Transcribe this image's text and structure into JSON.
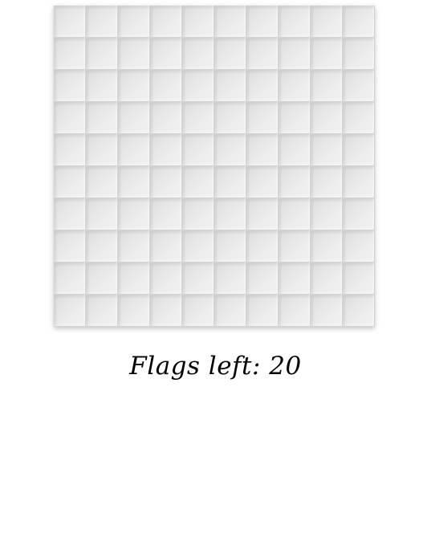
{
  "board": {
    "rows": 10,
    "columns": 10,
    "cell_state": "unrevealed",
    "cell_color": "#e6e6e6"
  },
  "status": {
    "flags_label": "Flags left: 20"
  }
}
